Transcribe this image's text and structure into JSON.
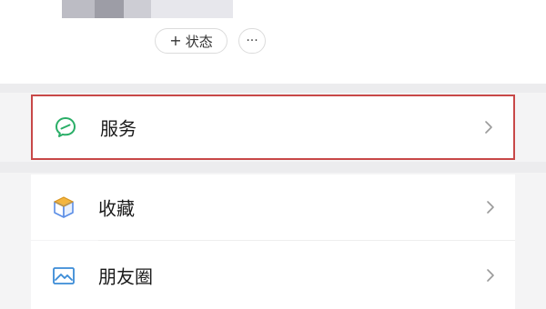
{
  "profile": {
    "status_button_label": "状态",
    "status_plus": "+",
    "more_button_label": "···"
  },
  "menu": {
    "items": [
      {
        "label": "服务",
        "icon": "service-icon",
        "highlighted": true
      },
      {
        "label": "收藏",
        "icon": "favorites-icon",
        "highlighted": false
      },
      {
        "label": "朋友圈",
        "icon": "moments-icon",
        "highlighted": false
      }
    ]
  },
  "colors": {
    "highlight_border": "#c84848",
    "service_icon": "#2aae67",
    "moments_icon": "#3a8bd6",
    "favorites_icon_top": "#f3b53f",
    "favorites_icon_side": "#5b8ee6"
  }
}
